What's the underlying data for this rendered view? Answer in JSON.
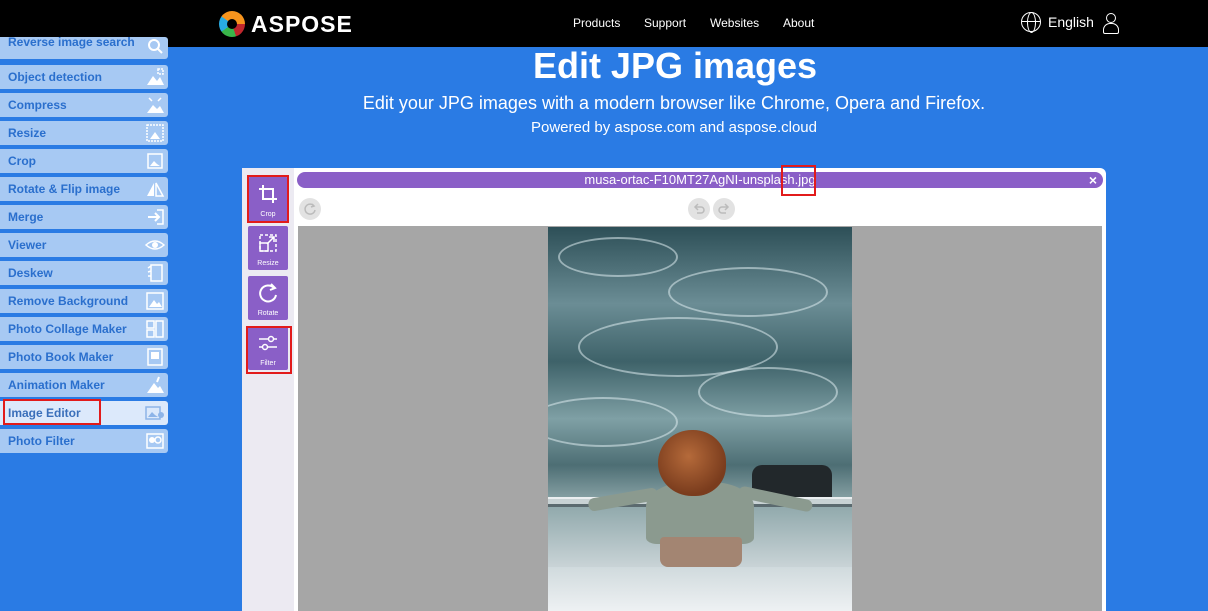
{
  "header": {
    "brand": "ASPOSE",
    "nav": [
      {
        "label": "Products"
      },
      {
        "label": "Support"
      },
      {
        "label": "Websites"
      },
      {
        "label": "About"
      }
    ],
    "language": "English"
  },
  "sidebar": {
    "items": [
      {
        "label": "Reverse image search",
        "icon": "search-image-icon"
      },
      {
        "label": "Object detection",
        "icon": "object-detection-icon"
      },
      {
        "label": "Compress",
        "icon": "compress-icon"
      },
      {
        "label": "Resize",
        "icon": "resize-icon"
      },
      {
        "label": "Crop",
        "icon": "crop-icon"
      },
      {
        "label": "Rotate & Flip image",
        "icon": "rotate-flip-icon"
      },
      {
        "label": "Merge",
        "icon": "merge-icon"
      },
      {
        "label": "Viewer",
        "icon": "eye-icon"
      },
      {
        "label": "Deskew",
        "icon": "deskew-icon"
      },
      {
        "label": "Remove Background",
        "icon": "remove-background-icon"
      },
      {
        "label": "Photo Collage Maker",
        "icon": "collage-icon"
      },
      {
        "label": "Photo Book Maker",
        "icon": "photo-book-icon"
      },
      {
        "label": "Animation Maker",
        "icon": "animation-icon"
      },
      {
        "label": "Image Editor",
        "icon": "image-editor-icon",
        "active": true
      },
      {
        "label": "Photo Filter",
        "icon": "photo-filter-icon"
      }
    ]
  },
  "hero": {
    "title": "Edit JPG images",
    "subtitle": "Edit your JPG images with a modern browser like Chrome, Opera and Firefox.",
    "powered": "Powered by aspose.com and aspose.cloud"
  },
  "editor": {
    "filename": "musa-ortac-F10MT27AgNI-unsplash.jpg",
    "tools": [
      {
        "label": "Crop",
        "icon": "crop-icon"
      },
      {
        "label": "Resize",
        "icon": "resize-icon"
      },
      {
        "label": "Rotate",
        "icon": "rotate-icon"
      },
      {
        "label": "Filter",
        "icon": "filter-icon"
      }
    ],
    "close": "×"
  },
  "colors": {
    "page_bg": "#2a7be4",
    "accent_purple": "#8a5fc7",
    "highlight_red": "#e21b1b"
  }
}
